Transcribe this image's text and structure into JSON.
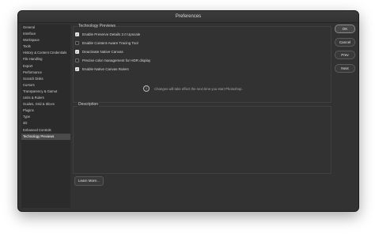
{
  "window": {
    "title": "Preferences"
  },
  "sidebar": {
    "items": [
      {
        "label": "General"
      },
      {
        "label": "Interface"
      },
      {
        "label": "Workspace"
      },
      {
        "label": "Tools"
      },
      {
        "label": "History & Content Credentials"
      },
      {
        "label": "File Handling"
      },
      {
        "label": "Export"
      },
      {
        "label": "Performance"
      },
      {
        "label": "Scratch Disks"
      },
      {
        "label": "Cursors"
      },
      {
        "label": "Transparency & Gamut"
      },
      {
        "label": "Units & Rulers"
      },
      {
        "label": "Guides, Grid & Slices"
      },
      {
        "label": "Plugins"
      },
      {
        "label": "Type"
      },
      {
        "label": "3D"
      },
      {
        "label": "Enhanced Controls"
      },
      {
        "label": "Technology Previews"
      }
    ],
    "selected": "Technology Previews"
  },
  "tech_previews": {
    "section_title": "Technology Previews",
    "options": [
      {
        "label": "Enable Preserve Details 2.0 Upscale",
        "checked": true
      },
      {
        "label": "Enable Content-Aware Tracing Tool",
        "checked": false
      },
      {
        "label": "Deactivate Native Canvas",
        "checked": true
      },
      {
        "label": "Precise color management for HDR display",
        "checked": false
      },
      {
        "label": "Enable Native Canvas Rulers",
        "checked": true
      }
    ],
    "info_text": "Changes will take effect the next time you start Photoshop."
  },
  "description": {
    "title": "Description"
  },
  "learn_more": {
    "label": "Learn More..."
  },
  "buttons": {
    "ok": "OK",
    "cancel": "Cancel",
    "prev": "Prev",
    "next": "Next"
  },
  "icons": {
    "check": "check-icon",
    "info": "info-icon"
  }
}
